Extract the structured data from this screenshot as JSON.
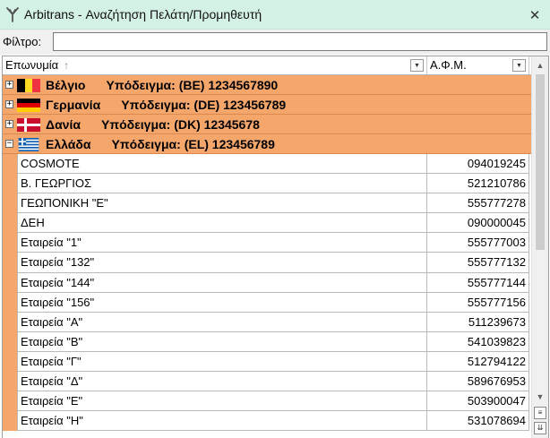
{
  "window": {
    "title": "Arbitrans - Αναζήτηση Πελάτη/Προμηθευτή",
    "close_glyph": "✕"
  },
  "filter": {
    "label": "Φίλτρο:",
    "value": ""
  },
  "grid": {
    "columns": [
      {
        "label": "Επωνυμία",
        "sort_glyph": "↑"
      },
      {
        "label": "Α.Φ.Μ."
      }
    ],
    "groups": [
      {
        "expander": "+",
        "flag": "flag-be",
        "country": "Βέλγιο",
        "sample": "Υπόδειγμα: (BE) 1234567890"
      },
      {
        "expander": "+",
        "flag": "flag-de",
        "country": "Γερμανία",
        "sample": "Υπόδειγμα: (DE) 123456789"
      },
      {
        "expander": "+",
        "flag": "flag-dk",
        "country": "Δανία",
        "sample": "Υπόδειγμα: (DK) 12345678"
      },
      {
        "expander": "−",
        "flag": "flag-gr",
        "country": "Ελλάδα",
        "sample": "Υπόδειγμα: (EL) 123456789"
      }
    ],
    "rows": [
      {
        "name": "COSMOTE",
        "afm": "094019245"
      },
      {
        "name": "Β. ΓΕΩΡΓΙΟΣ",
        "afm": "521210786"
      },
      {
        "name": "ΓΕΩΠΟΝΙΚΗ \"Ε\"",
        "afm": "555777278"
      },
      {
        "name": "ΔΕΗ",
        "afm": "090000045"
      },
      {
        "name": "Εταιρεία \"1\"",
        "afm": "555777003"
      },
      {
        "name": "Εταιρεία \"132\"",
        "afm": "555777132"
      },
      {
        "name": "Εταιρεία \"144\"",
        "afm": "555777144"
      },
      {
        "name": "Εταιρεία \"156\"",
        "afm": "555777156"
      },
      {
        "name": "Εταιρεία \"Α\"",
        "afm": "511239673"
      },
      {
        "name": "Εταιρεία \"Β\"",
        "afm": "541039823"
      },
      {
        "name": "Εταιρεία \"Γ\"",
        "afm": "512794122"
      },
      {
        "name": "Εταιρεία \"Δ\"",
        "afm": "589676953"
      },
      {
        "name": "Εταιρεία \"Ε\"",
        "afm": "503900047"
      },
      {
        "name": "Εταιρεία \"Η\"",
        "afm": "531078694"
      }
    ]
  },
  "colors": {
    "group_row": "#f4a66b",
    "titlebar": "#d4f1e6"
  }
}
